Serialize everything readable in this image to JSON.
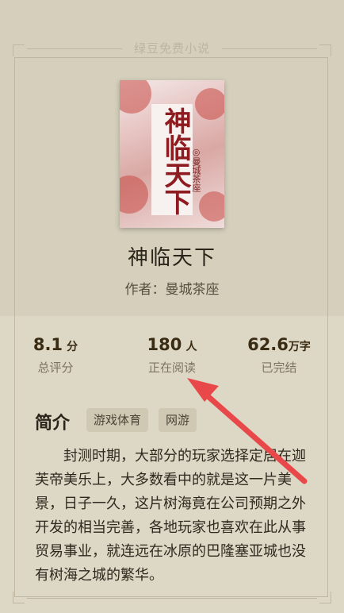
{
  "brand": "绿豆免费小说",
  "book": {
    "title": "神临天下",
    "author_line": "作者：曼城茶座",
    "cover_title": "神临天下",
    "cover_author": "◎曼城茶座"
  },
  "stats": [
    {
      "value": "8.1",
      "unit": "分",
      "label": "总评分"
    },
    {
      "value": "180",
      "unit": "人",
      "label": "正在阅读"
    },
    {
      "value": "62.6",
      "unit": "万字",
      "label": "已完结"
    }
  ],
  "intro": {
    "heading": "简介",
    "tags": [
      "游戏体育",
      "网游"
    ],
    "text": "封测时期，大部分的玩家选择定居在迦芙帝美乐上，大多数看中的就是这一片美景，日子一久，这片树海竟在公司预期之外开发的相当完善，各地玩家也喜欢在此从事贸易事业，就连远在冰原的巴隆塞亚城也没有树海之城的繁华。"
  },
  "colors": {
    "arrow": "#e8484a",
    "accent_dark": "#3a2b13"
  }
}
